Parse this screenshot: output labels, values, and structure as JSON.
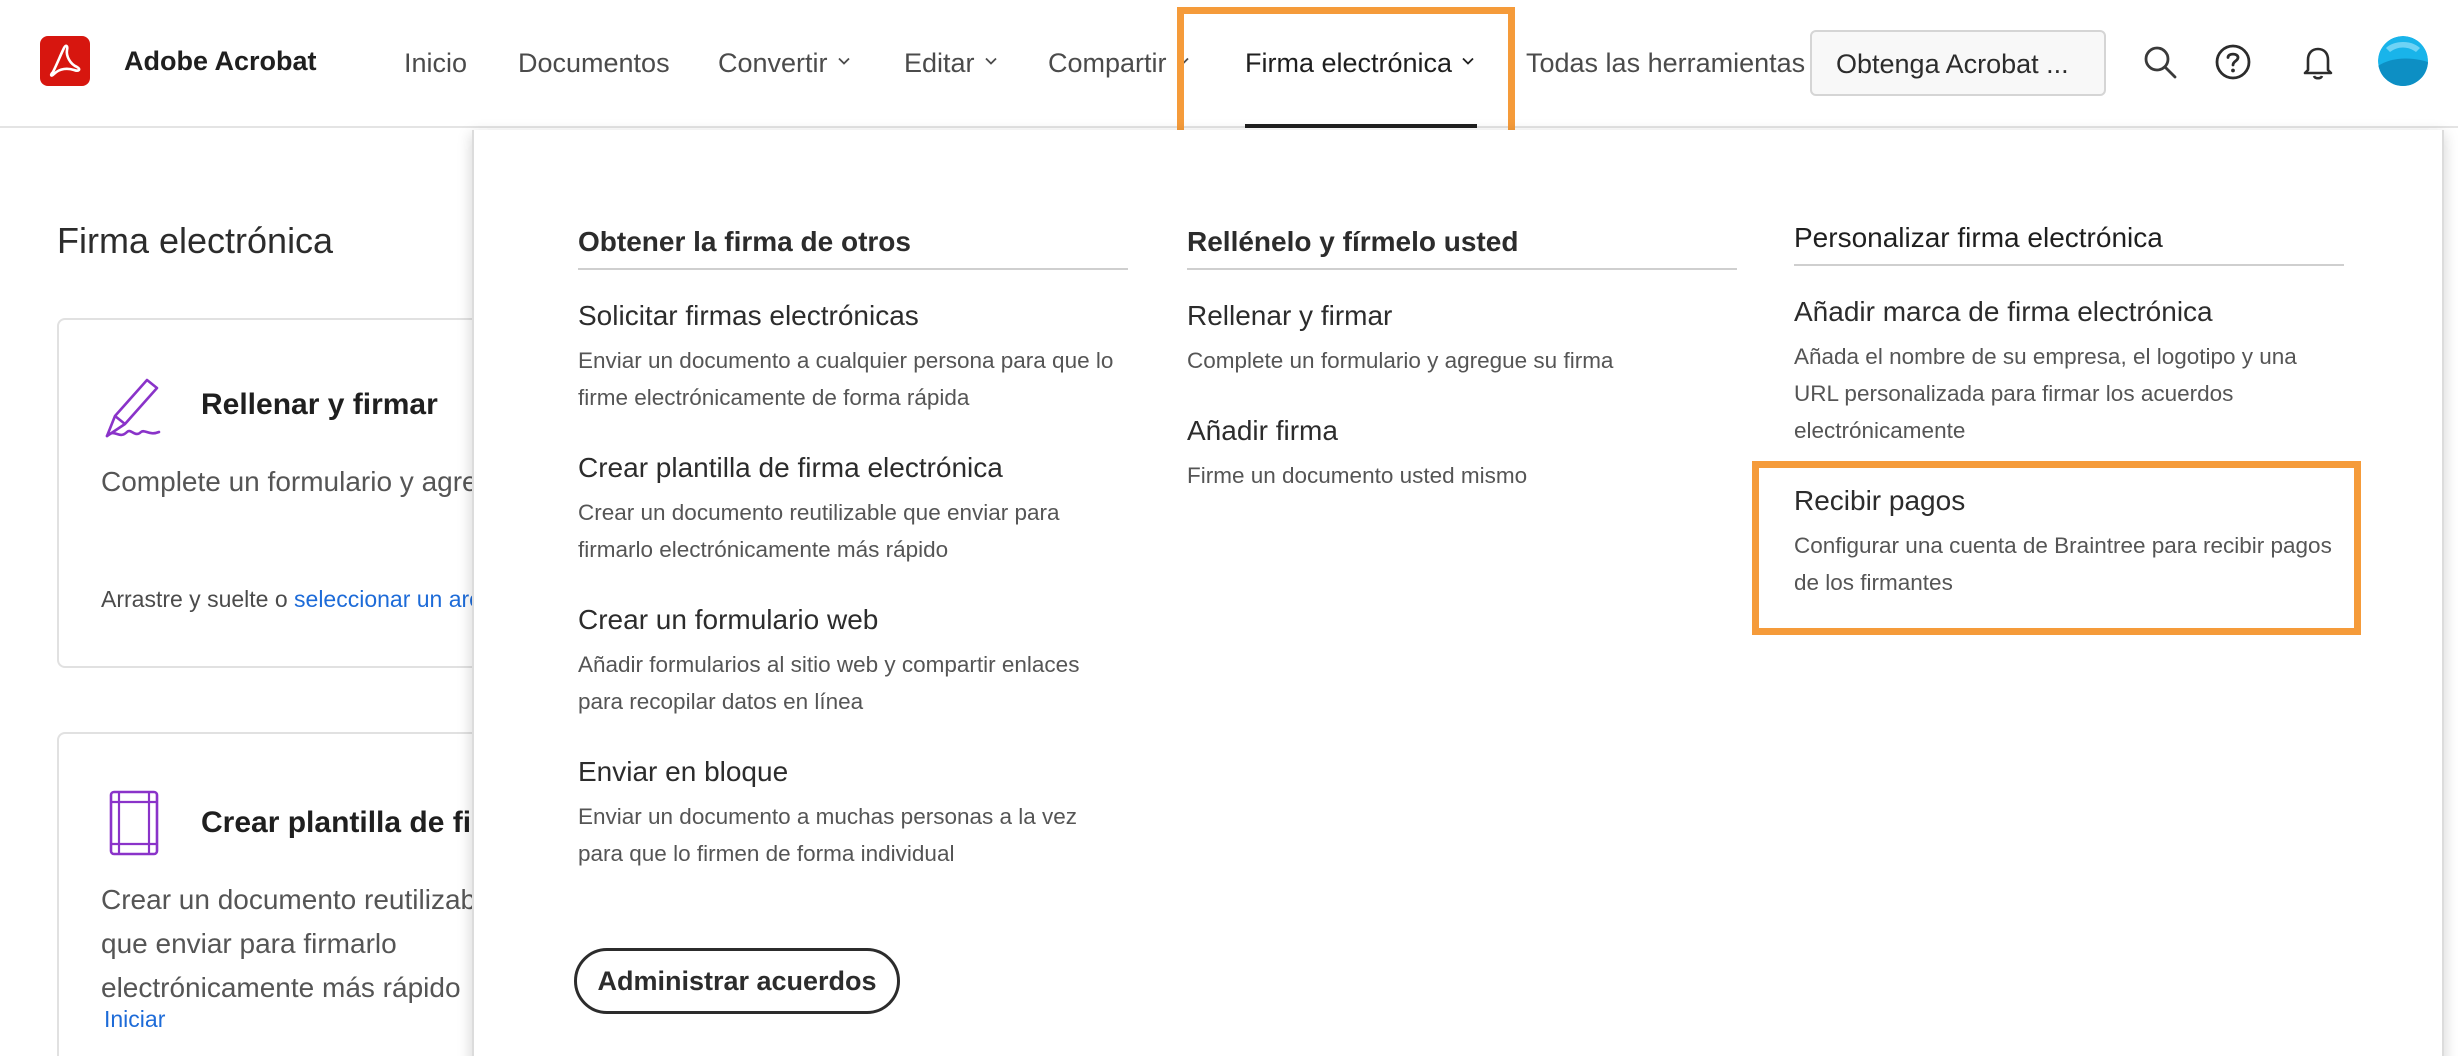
{
  "app": {
    "brand": "Adobe Acrobat"
  },
  "nav": {
    "items": [
      {
        "label": "Inicio",
        "dropdown": false
      },
      {
        "label": "Documentos",
        "dropdown": false
      },
      {
        "label": "Convertir",
        "dropdown": true
      },
      {
        "label": "Editar",
        "dropdown": true
      },
      {
        "label": "Compartir",
        "dropdown": true
      },
      {
        "label": "Firma electrónica",
        "dropdown": true,
        "active": true
      },
      {
        "label": "Todas las herramientas",
        "dropdown": false
      }
    ],
    "get_acrobat": "Obtenga Acrobat ...",
    "icons": [
      "search-icon",
      "help-icon",
      "bell-icon",
      "avatar"
    ]
  },
  "page": {
    "title": "Firma electrónica",
    "cards": [
      {
        "title": "Rellenar y firmar",
        "desc": "Complete un formulario y agregue su firma",
        "foot_text": "Arrastre y suelte o ",
        "foot_link": "seleccionar un archivo"
      },
      {
        "title": "Crear plantilla de firma electrónica",
        "desc": "Crear un documento reutilizable que enviar para firmarlo electrónicamente más rápido",
        "link": "Iniciar"
      }
    ]
  },
  "dropdown": {
    "columns": [
      {
        "heading": "Obtener la firma de otros",
        "items": [
          {
            "title": "Solicitar firmas electrónicas",
            "desc": "Enviar un documento a cualquier persona para que lo firme electrónicamente de forma rápida"
          },
          {
            "title": "Crear plantilla de firma electrónica",
            "desc": "Crear un documento reutilizable que enviar para firmarlo electrónicamente más rápido"
          },
          {
            "title": "Crear un formulario web",
            "desc": "Añadir formularios al sitio web y compartir enlaces para recopilar datos en línea"
          },
          {
            "title": "Enviar en bloque",
            "desc": "Enviar un documento a muchas personas a la vez para que lo firmen de forma individual"
          }
        ]
      },
      {
        "heading": "Rellénelo y fírmelo usted",
        "items": [
          {
            "title": "Rellenar y firmar",
            "desc": "Complete un formulario y agregue su firma"
          },
          {
            "title": "Añadir firma",
            "desc": "Firme un documento usted mismo"
          }
        ]
      },
      {
        "heading": "Personalizar firma electrónica",
        "items": [
          {
            "title": "Añadir marca de firma electrónica",
            "desc": "Añada el nombre de su empresa, el logotipo y una URL personalizada para firmar los acuerdos electrónicamente"
          },
          {
            "title": "Recibir pagos",
            "desc": "Configurar una cuenta de Braintree para recibir pagos de los firmantes",
            "highlighted": true
          }
        ]
      }
    ],
    "manage_button": "Administrar acuerdos"
  },
  "colors": {
    "highlight": "#f59b3a",
    "brand": "#d7160f",
    "link": "#1d6bd8",
    "icon_purple": "#8a33c9"
  }
}
